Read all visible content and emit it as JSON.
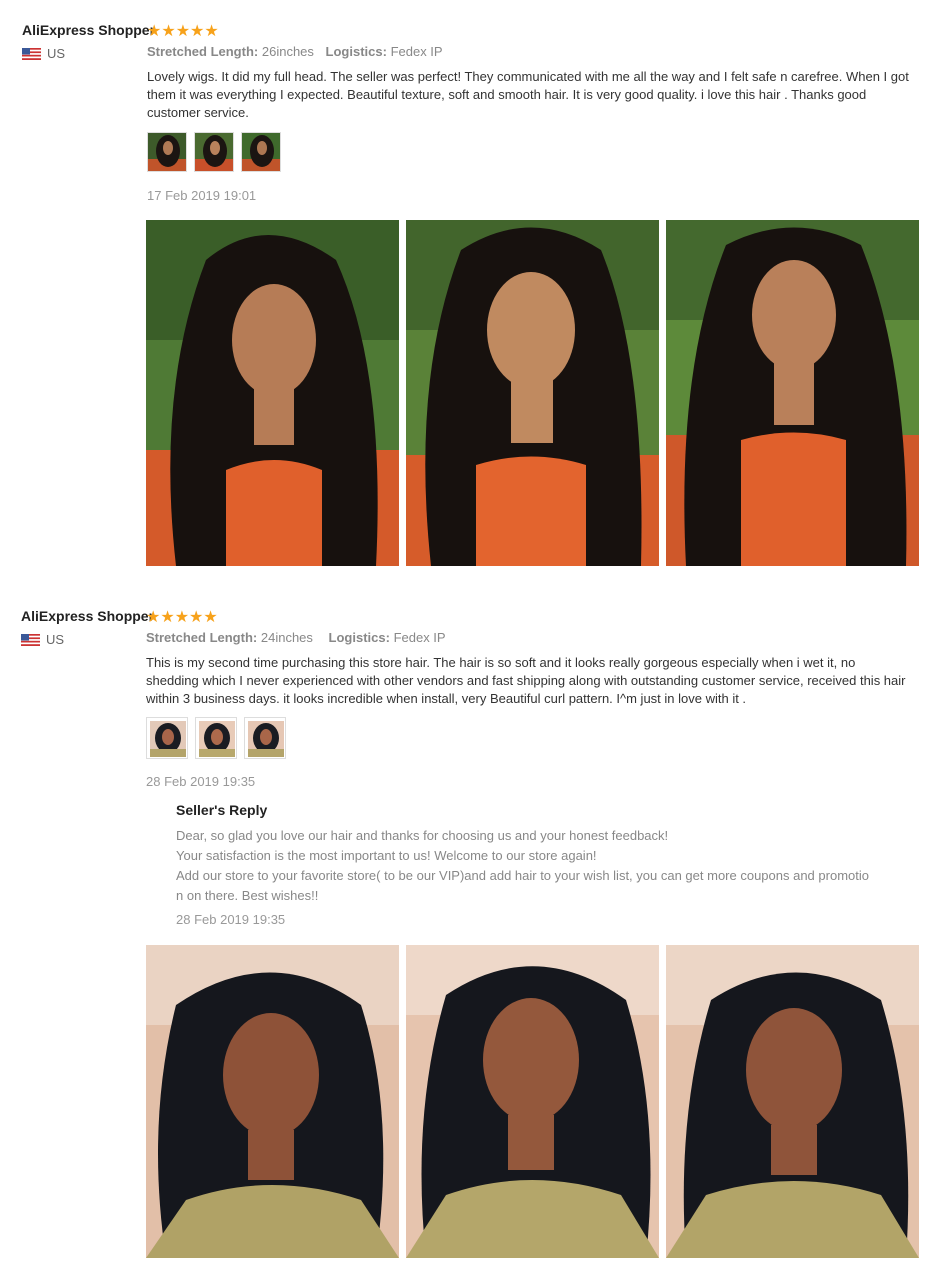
{
  "reviews": [
    {
      "user": "AliExpress Shopper",
      "stars": "★★★★★",
      "rating": 5,
      "country": "US",
      "length_label": "Stretched Length:",
      "length_value": "26inches",
      "logistics_label": "Logistics:",
      "logistics_value": "Fedex IP",
      "text": "Lovely wigs. It did my full head. The seller was perfect! They communicated with me all the way and I felt safe n carefree. When I got them it was everything I expected. Beautiful texture, soft and smooth hair. It is very good quality. i love this hair . Thanks good customer service.",
      "date": "17 Feb 2019 19:01"
    },
    {
      "user": "AliExpress Shopper",
      "stars": "★★★★★",
      "rating": 5,
      "country": "US",
      "length_label": "Stretched Length:",
      "length_value": "24inches",
      "logistics_label": "Logistics:",
      "logistics_value": "Fedex IP",
      "text": "This is my second time purchasing this store hair. The hair is so soft and it looks really gorgeous especially when i wet it, no shedding which I never experienced with other vendors and fast shipping along with outstanding customer service, received this hair within 3 business days. it looks incredible when install, very Beautiful curl pattern. I^m just in love with it .",
      "date": "28 Feb 2019 19:35",
      "reply": {
        "title": "Seller's Reply",
        "lines": [
          "Dear, so glad you love our hair and thanks for choosing us and your honest feedback!",
          "Your satisfaction is the most important to us! Welcome to our store again!",
          "Add our store to your favorite store( to be our VIP)and add hair to your wish list, you can get more coupons and promotio",
          "n on there. Best wishes!!"
        ],
        "date": "28 Feb 2019 19:35"
      }
    }
  ],
  "colors": {
    "star": "#f7a21b",
    "meta": "#888888",
    "text": "#333333"
  }
}
